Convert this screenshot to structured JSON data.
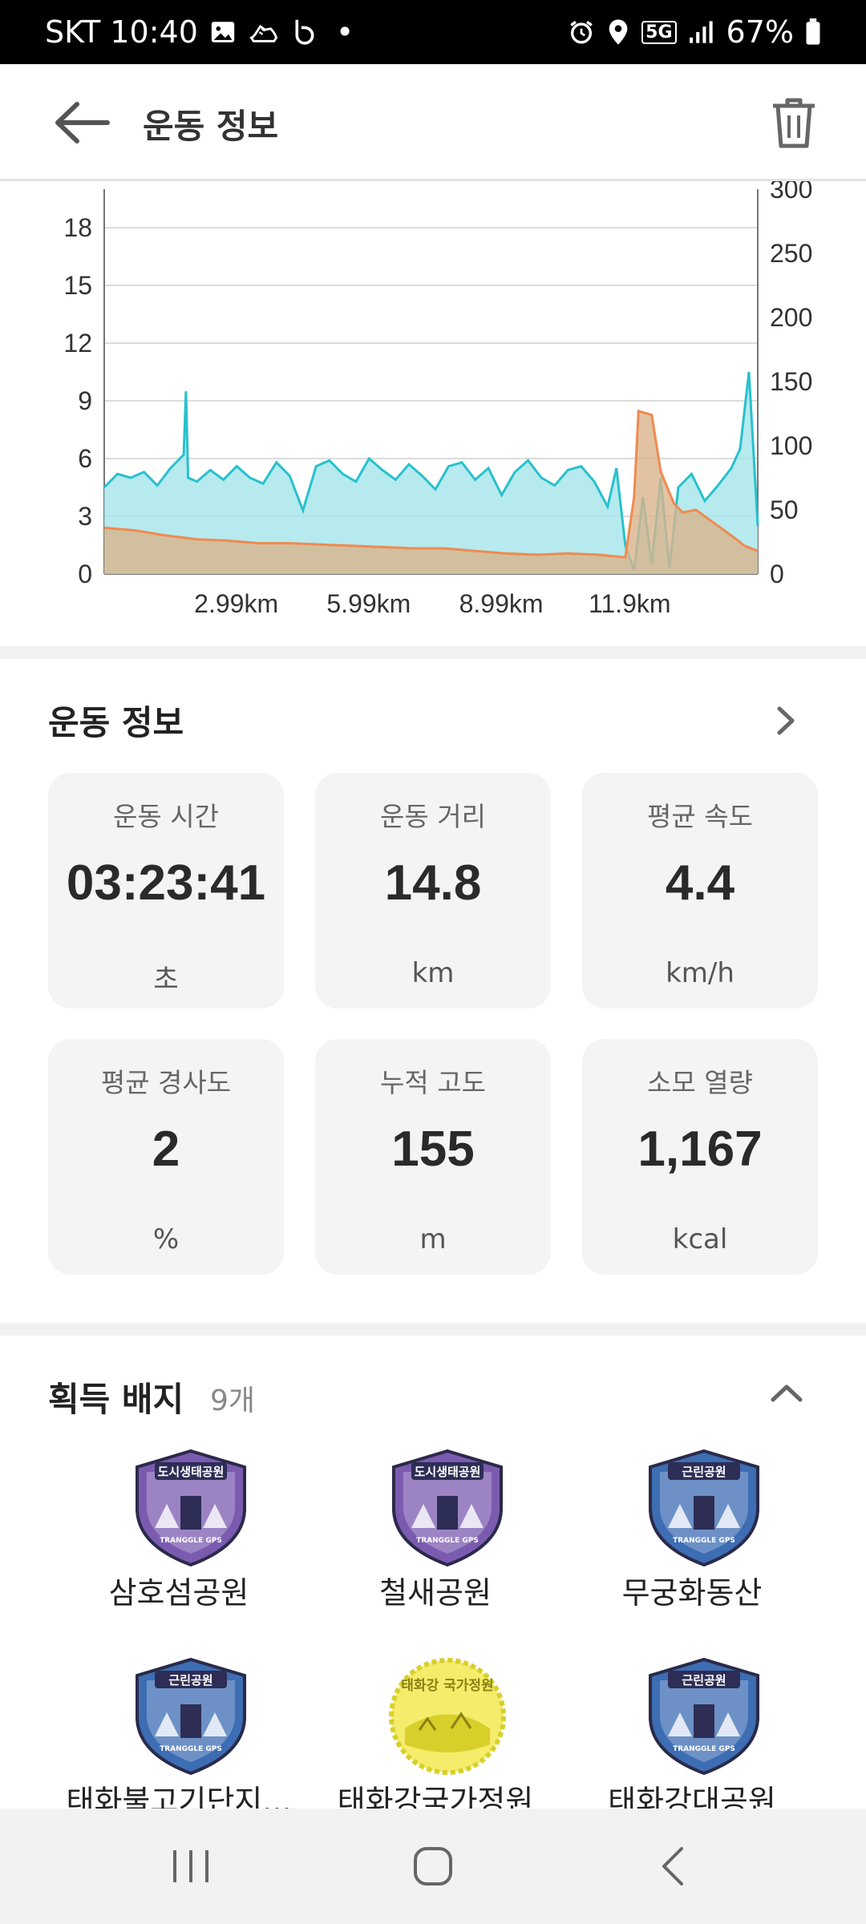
{
  "status_bar": {
    "carrier_time": "SKT 10:40",
    "dot": "•",
    "network": "5G",
    "battery": "67%",
    "icons": [
      "image-icon",
      "running-shoe-icon",
      "b-app-icon",
      "alarm-icon",
      "location-icon",
      "signal-icon",
      "battery-icon"
    ]
  },
  "app_bar": {
    "title": "운동 정보",
    "back_icon": "arrow-left-icon",
    "trash_icon": "trash-icon"
  },
  "chart_data": {
    "type": "area",
    "x_tick_labels": [
      "2.99km",
      "5.99km",
      "8.99km",
      "11.9km"
    ],
    "x_ticks_km": [
      2.99,
      5.99,
      8.99,
      11.9
    ],
    "x_range_km": [
      0,
      14.8
    ],
    "y_left_ticks": [
      0,
      3,
      6,
      9,
      12,
      15,
      18
    ],
    "y_left_range": [
      0,
      20
    ],
    "y_right_ticks": [
      0,
      50,
      100,
      150,
      200,
      250,
      300
    ],
    "y_right_range": [
      0,
      300
    ],
    "grid": true,
    "series": [
      {
        "axis": "left",
        "color": "#27c1cd",
        "fill": "#a9e6ec",
        "x_km": [
          0.0,
          0.3,
          0.6,
          0.9,
          1.2,
          1.5,
          1.8,
          1.85,
          1.9,
          2.1,
          2.4,
          2.7,
          3.0,
          3.3,
          3.6,
          3.9,
          4.2,
          4.5,
          4.8,
          5.1,
          5.4,
          5.7,
          6.0,
          6.3,
          6.6,
          6.9,
          7.2,
          7.5,
          7.8,
          8.1,
          8.4,
          8.7,
          9.0,
          9.3,
          9.6,
          9.9,
          10.2,
          10.5,
          10.8,
          11.1,
          11.4,
          11.6,
          11.8,
          12.0,
          12.2,
          12.4,
          12.6,
          12.8,
          13.0,
          13.3,
          13.6,
          13.9,
          14.2,
          14.4,
          14.6,
          14.8
        ],
        "values": [
          4.5,
          5.2,
          5.0,
          5.3,
          4.6,
          5.5,
          6.2,
          9.5,
          5.0,
          4.8,
          5.4,
          4.9,
          5.6,
          5.0,
          4.7,
          5.8,
          5.1,
          3.3,
          5.6,
          5.9,
          5.2,
          4.8,
          6.0,
          5.4,
          4.9,
          5.7,
          5.1,
          4.4,
          5.6,
          5.8,
          4.9,
          5.5,
          4.1,
          5.3,
          5.9,
          5.0,
          4.6,
          5.4,
          5.6,
          4.8,
          3.5,
          5.5,
          1.5,
          0.2,
          4.0,
          0.5,
          5.0,
          0.3,
          4.5,
          5.2,
          3.8,
          4.6,
          5.5,
          6.5,
          10.5,
          2.5
        ]
      },
      {
        "axis": "right",
        "color": "#ef8a4f",
        "fill": "#d9b48c",
        "x_km": [
          0.0,
          0.7,
          1.4,
          2.1,
          2.8,
          3.5,
          4.2,
          4.9,
          5.6,
          6.3,
          7.0,
          7.7,
          8.4,
          9.1,
          9.8,
          10.5,
          11.2,
          11.8,
          12.0,
          12.1,
          12.4,
          12.6,
          12.9,
          13.1,
          13.4,
          13.8,
          14.2,
          14.5,
          14.8
        ],
        "values": [
          36,
          34,
          30,
          27,
          26,
          24,
          24,
          23,
          22,
          21,
          20,
          20,
          18,
          16,
          15,
          16,
          15,
          13,
          60,
          127,
          124,
          80,
          55,
          48,
          50,
          40,
          30,
          22,
          18
        ]
      }
    ]
  },
  "workout_info": {
    "title": "운동 정보",
    "chevron_icon": "chevron-right-icon",
    "cards": [
      {
        "label": "운동 시간",
        "value": "03:23:41",
        "unit": "초"
      },
      {
        "label": "운동 거리",
        "value": "14.8",
        "unit": "km"
      },
      {
        "label": "평균 속도",
        "value": "4.4",
        "unit": "km/h"
      },
      {
        "label": "평균 경사도",
        "value": "2",
        "unit": "%"
      },
      {
        "label": "누적 고도",
        "value": "155",
        "unit": "m"
      },
      {
        "label": "소모 열량",
        "value": "1,167",
        "unit": "kcal"
      }
    ]
  },
  "badges": {
    "title": "획득 배지",
    "count": "9개",
    "collapse_icon": "chevron-up-icon",
    "items": [
      {
        "name": "삼호섬공원",
        "badge_text": "도시생태공원",
        "footer_text": "TRANGGLE GPS",
        "color": "#7b5bb0"
      },
      {
        "name": "철새공원",
        "badge_text": "도시생태공원",
        "footer_text": "TRANGGLE GPS",
        "color": "#7b5bb0"
      },
      {
        "name": "무궁화동산",
        "badge_text": "근린공원",
        "footer_text": "TRANGGLE GPS",
        "color": "#3d6db3"
      },
      {
        "name": "태화불고기단지...",
        "badge_text": "근린공원",
        "footer_text": "TRANGGLE GPS",
        "color": "#3d6db3"
      },
      {
        "name": "태화강국가정원",
        "badge_text": "태화강 국가정원",
        "footer_text": "",
        "color": "#d8cf2a"
      },
      {
        "name": "태화강대공원",
        "badge_text": "근린공원",
        "footer_text": "TRANGGLE GPS",
        "color": "#3d6db3"
      }
    ]
  },
  "nav_bar": {
    "icons": [
      "recent-apps-icon",
      "home-icon",
      "back-icon"
    ]
  }
}
